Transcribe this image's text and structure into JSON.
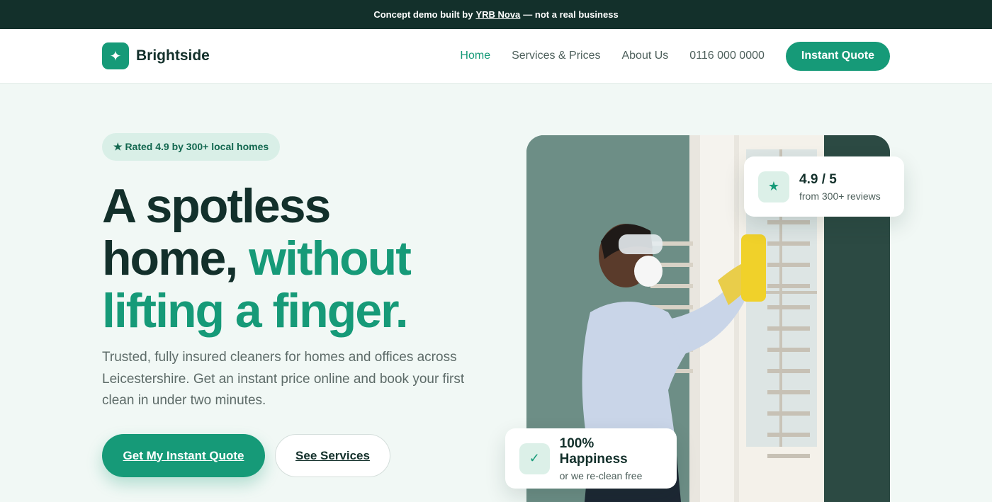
{
  "banner": {
    "prefix": "Concept demo built by",
    "link": "YRB Nova",
    "suffix": "— not a real business"
  },
  "nav": {
    "logo_icon": "sparkle-icon",
    "brand": "Brightside",
    "links": [
      "Home",
      "Services & Prices",
      "About Us",
      "0116 000 0000"
    ],
    "active": "Home",
    "cta": "Instant Quote"
  },
  "hero": {
    "badge": "★ Rated 4.9 by 300+ local homes",
    "headline_line1": "A spotless",
    "headline_line2a": "home,",
    "headline_line2b": "without",
    "headline_line3": "lifting a finger.",
    "subtext": "Trusted, fully insured cleaners for homes and offices across Leicestershire. Get an instant price online and book your first clean in under two minutes.",
    "primary_cta": "Get My Instant Quote",
    "secondary_cta": "See Services"
  },
  "rating_card": {
    "icon": "star-icon",
    "title": "4.9 / 5",
    "subtitle": "from 300+ reviews"
  },
  "happiness_card": {
    "icon": "check-icon",
    "title": "100% Happiness",
    "subtitle": "or we re-clean free"
  },
  "colors": {
    "brand_green": "#169a78",
    "dark_teal": "#13302b",
    "page_bg": "#f1f8f5"
  }
}
